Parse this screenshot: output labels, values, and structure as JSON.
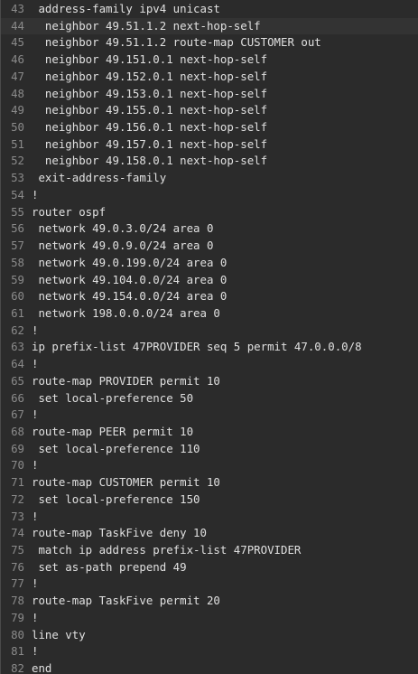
{
  "editor": {
    "active_line": 44,
    "lines": [
      {
        "n": "43",
        "text": " address-family ipv4 unicast"
      },
      {
        "n": "44",
        "text": "  neighbor 49.51.1.2 next-hop-self"
      },
      {
        "n": "45",
        "text": "  neighbor 49.51.1.2 route-map CUSTOMER out"
      },
      {
        "n": "46",
        "text": "  neighbor 49.151.0.1 next-hop-self"
      },
      {
        "n": "47",
        "text": "  neighbor 49.152.0.1 next-hop-self"
      },
      {
        "n": "48",
        "text": "  neighbor 49.153.0.1 next-hop-self"
      },
      {
        "n": "49",
        "text": "  neighbor 49.155.0.1 next-hop-self"
      },
      {
        "n": "50",
        "text": "  neighbor 49.156.0.1 next-hop-self"
      },
      {
        "n": "51",
        "text": "  neighbor 49.157.0.1 next-hop-self"
      },
      {
        "n": "52",
        "text": "  neighbor 49.158.0.1 next-hop-self"
      },
      {
        "n": "53",
        "text": " exit-address-family"
      },
      {
        "n": "54",
        "text": "!"
      },
      {
        "n": "55",
        "text": "router ospf"
      },
      {
        "n": "56",
        "text": " network 49.0.3.0/24 area 0"
      },
      {
        "n": "57",
        "text": " network 49.0.9.0/24 area 0"
      },
      {
        "n": "58",
        "text": " network 49.0.199.0/24 area 0"
      },
      {
        "n": "59",
        "text": " network 49.104.0.0/24 area 0"
      },
      {
        "n": "60",
        "text": " network 49.154.0.0/24 area 0"
      },
      {
        "n": "61",
        "text": " network 198.0.0.0/24 area 0"
      },
      {
        "n": "62",
        "text": "!"
      },
      {
        "n": "63",
        "text": "ip prefix-list 47PROVIDER seq 5 permit 47.0.0.0/8"
      },
      {
        "n": "64",
        "text": "!"
      },
      {
        "n": "65",
        "text": "route-map PROVIDER permit 10"
      },
      {
        "n": "66",
        "text": " set local-preference 50"
      },
      {
        "n": "67",
        "text": "!"
      },
      {
        "n": "68",
        "text": "route-map PEER permit 10"
      },
      {
        "n": "69",
        "text": " set local-preference 110"
      },
      {
        "n": "70",
        "text": "!"
      },
      {
        "n": "71",
        "text": "route-map CUSTOMER permit 10"
      },
      {
        "n": "72",
        "text": " set local-preference 150"
      },
      {
        "n": "73",
        "text": "!"
      },
      {
        "n": "74",
        "text": "route-map TaskFive deny 10"
      },
      {
        "n": "75",
        "text": " match ip address prefix-list 47PROVIDER"
      },
      {
        "n": "76",
        "text": " set as-path prepend 49"
      },
      {
        "n": "77",
        "text": "!"
      },
      {
        "n": "78",
        "text": "route-map TaskFive permit 20"
      },
      {
        "n": "79",
        "text": "!"
      },
      {
        "n": "80",
        "text": "line vty"
      },
      {
        "n": "81",
        "text": "!"
      },
      {
        "n": "82",
        "text": "end"
      }
    ]
  }
}
